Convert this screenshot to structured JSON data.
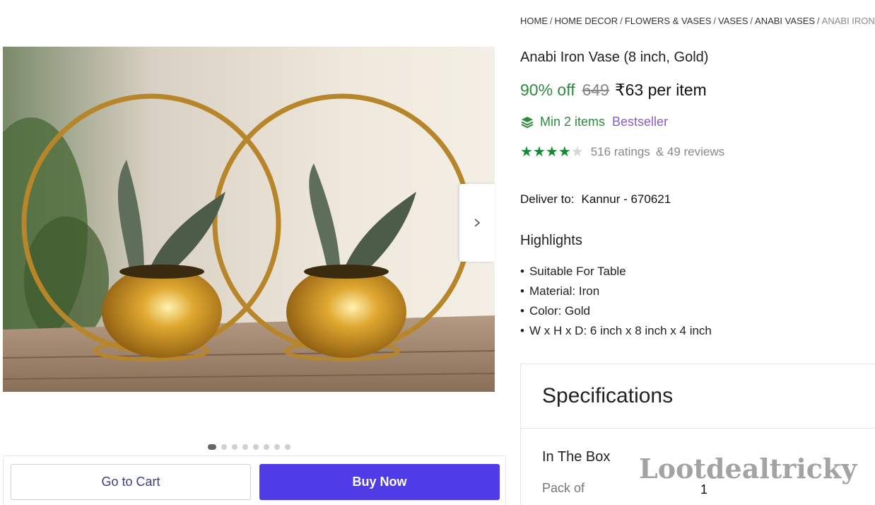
{
  "breadcrumb": [
    {
      "label": "HOME"
    },
    {
      "label": "HOME DECOR"
    },
    {
      "label": "FLOWERS & VASES"
    },
    {
      "label": "VASES"
    },
    {
      "label": "ANABI VASES"
    },
    {
      "label": "ANABI IRON VASE"
    }
  ],
  "breadcrumb_separator": "/",
  "product": {
    "title": "Anabi Iron Vase (8 inch, Gold)",
    "discount": "90% off",
    "mrp": "649",
    "price": "₹63 per item",
    "min_items": "Min 2 items",
    "badge": "Bestseller",
    "rating_stars": 4,
    "ratings": "516 ratings",
    "reviews": "& 49 reviews"
  },
  "delivery": {
    "label": "Deliver to:",
    "location": "Kannur - 670621"
  },
  "highlights": {
    "title": "Highlights",
    "items": [
      "Suitable For Table",
      "Material: Iron",
      "Color: Gold",
      "W x H x D: 6 inch x 8 inch x 4 inch"
    ]
  },
  "specifications": {
    "title": "Specifications",
    "section": "In The Box",
    "key": "Pack of",
    "value": "1"
  },
  "carousel": {
    "dots": 8,
    "active": 0
  },
  "actions": {
    "cart_label": "Go to Cart",
    "buy_label": "Buy Now"
  },
  "watermark": "Lootdealtricky",
  "colors": {
    "discount": "#2e8b3e",
    "bestseller": "#8b5fbf",
    "buy_button": "#4e3ce6",
    "star": "#138a36"
  }
}
